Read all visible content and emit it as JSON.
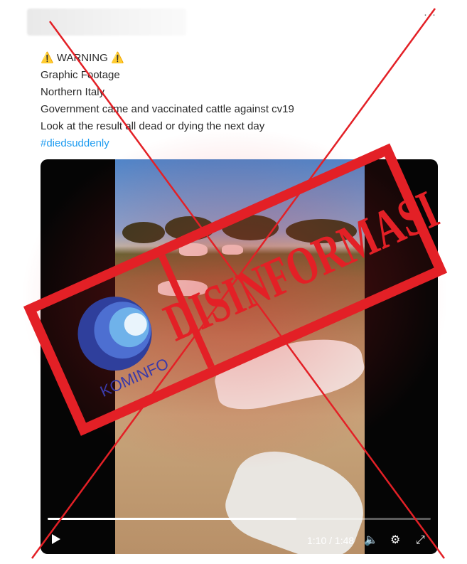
{
  "tweet": {
    "warning_icon": "warning-icon",
    "warning_label": "WARNING",
    "lines": [
      "Graphic Footage",
      "Northern Italy",
      "Government came and vaccinated cattle against cv19",
      "Look at the result all dead or dying the next day"
    ],
    "hashtag": "#diedsuddenly"
  },
  "video": {
    "current_time": "1:10",
    "duration": "1:48",
    "time_separator": " / ",
    "progress_fraction": 0.65
  },
  "stamp": {
    "label": "DISINFORMASI",
    "color": "#e32026"
  },
  "logo": {
    "label": "KOMINFO",
    "color": "#3a3aa8"
  }
}
